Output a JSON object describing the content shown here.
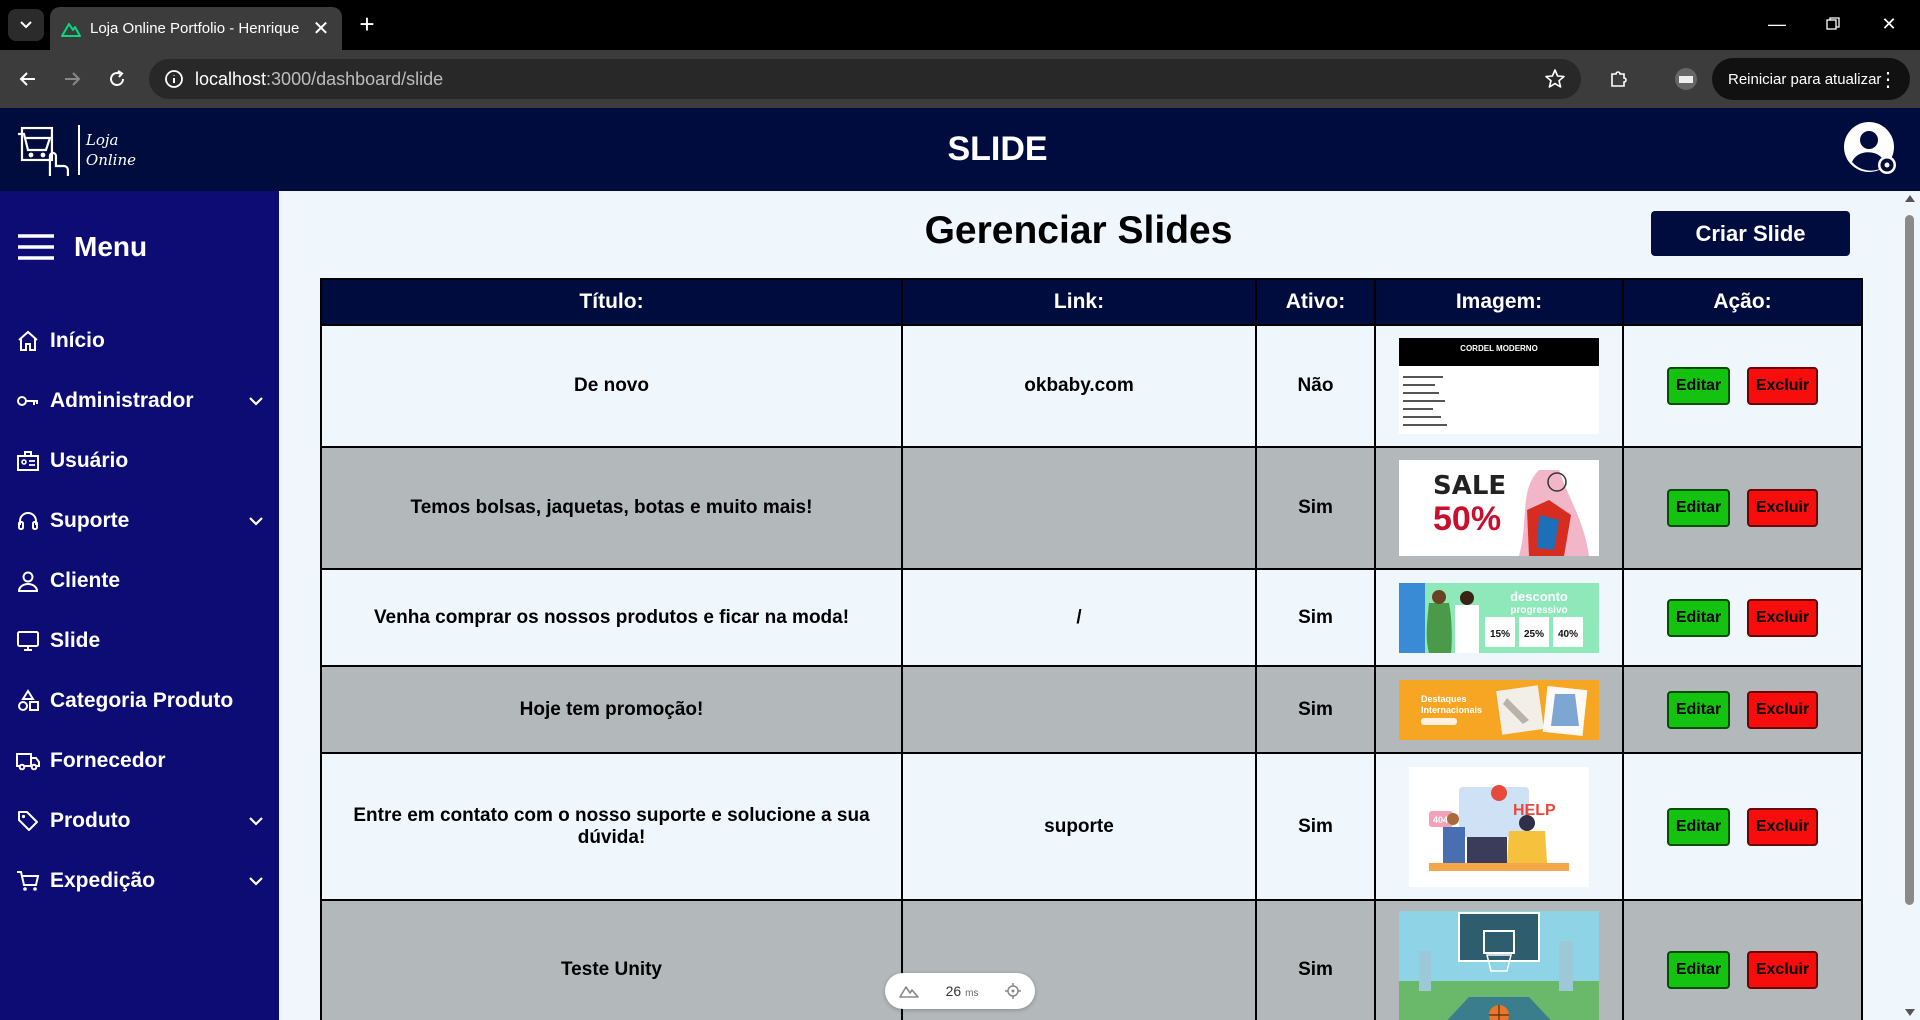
{
  "browser": {
    "tab_title": "Loja Online Portfolio - Henrique",
    "url_host": "localhost",
    "url_path": ":3000/dashboard/slide",
    "update_label": "Reiniciar para atualizar"
  },
  "header": {
    "logo_line1": "Loja",
    "logo_line2": "Online",
    "page_title": "SLIDE"
  },
  "sidebar": {
    "menu_label": "Menu",
    "items": [
      {
        "label": "Início",
        "icon": "home-icon",
        "has_submenu": false
      },
      {
        "label": "Administrador",
        "icon": "key-icon",
        "has_submenu": true
      },
      {
        "label": "Usuário",
        "icon": "id-card-icon",
        "has_submenu": false
      },
      {
        "label": "Suporte",
        "icon": "headset-icon",
        "has_submenu": true
      },
      {
        "label": "Cliente",
        "icon": "person-icon",
        "has_submenu": false
      },
      {
        "label": "Slide",
        "icon": "monitor-icon",
        "has_submenu": false
      },
      {
        "label": "Categoria Produto",
        "icon": "shapes-icon",
        "has_submenu": false
      },
      {
        "label": "Fornecedor",
        "icon": "truck-icon",
        "has_submenu": false
      },
      {
        "label": "Produto",
        "icon": "tag-icon",
        "has_submenu": true
      },
      {
        "label": "Expedição",
        "icon": "cart-icon",
        "has_submenu": true
      }
    ]
  },
  "main": {
    "title": "Gerenciar Slides",
    "create_button": "Criar Slide",
    "columns": [
      "Título:",
      "Link:",
      "Ativo:",
      "Imagem:",
      "Ação:"
    ],
    "edit_label": "Editar",
    "delete_label": "Excluir",
    "rows": [
      {
        "titulo": "De novo",
        "link": "okbaby.com",
        "ativo": "Não",
        "image": "cordel-moderno-thumbnail"
      },
      {
        "titulo": "Temos bolsas, jaquetas, botas e muito mais!",
        "link": "",
        "ativo": "Sim",
        "image": "sale-50-thumbnail"
      },
      {
        "titulo": "Venha comprar os nossos produtos e ficar na moda!",
        "link": "/",
        "ativo": "Sim",
        "image": "desconto-progressivo-thumbnail"
      },
      {
        "titulo": "Hoje tem promoção!",
        "link": "",
        "ativo": "Sim",
        "image": "destaques-internacionais-thumbnail"
      },
      {
        "titulo": "Entre em contato com o nosso suporte e solucione a sua dúvida!",
        "link": "suporte",
        "ativo": "Sim",
        "image": "help-support-thumbnail"
      },
      {
        "titulo": "Teste Unity",
        "link": "",
        "ativo": "Sim",
        "image": "basketball-game-thumbnail"
      }
    ],
    "thumb_text": {
      "cordel": "CORDEL MODERNO",
      "sale": "SALE",
      "sale_pct": "50%",
      "desconto": "desconto",
      "desconto_sub": "progressivo",
      "pcts": [
        "15%",
        "25%",
        "40%"
      ],
      "destaques": "Destaques",
      "destaques_sub": "Internacionais",
      "help": "HELP",
      "err": "404"
    }
  },
  "dev_overlay": {
    "time_value": "26",
    "time_unit": "ms"
  },
  "colors": {
    "header_bg": "#010c3e",
    "sidebar_bg": "#0d0c74",
    "edit_green": "#13c310",
    "delete_red": "#f80d0d",
    "row_gray": "#b3b8bb",
    "page_bg": "#f0f7fc"
  }
}
